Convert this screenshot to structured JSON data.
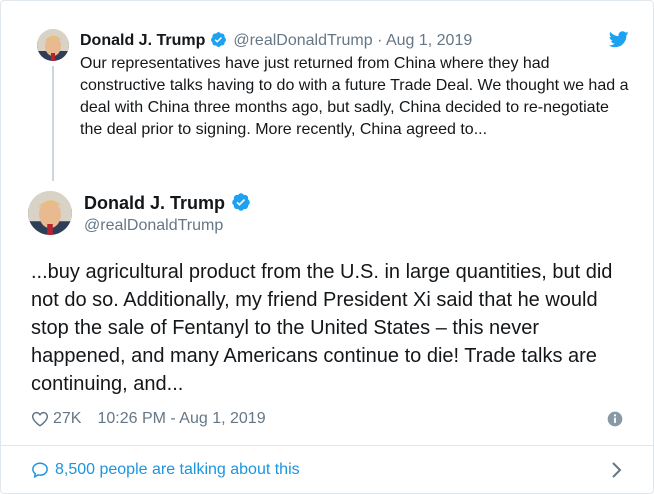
{
  "quoted": {
    "name": "Donald J. Trump",
    "handle": "@realDonaldTrump",
    "separator": "·",
    "date": "Aug 1, 2019",
    "text": "Our representatives have just returned from China where they had constructive talks having to do with a future Trade Deal. We thought we had a deal with China three months ago, but sadly, China decided to re-negotiate the deal prior to signing. More recently, China agreed to..."
  },
  "main": {
    "name": "Donald J. Trump",
    "handle": "@realDonaldTrump",
    "text": "...buy agricultural product from the U.S. in large quantities, but did not do so. Additionally, my friend President Xi said that he would stop the sale of Fentanyl to the United States – this never happened, and many Americans continue to die! Trade talks are continuing, and...",
    "likes": "27K",
    "timestamp": "10:26 PM - Aug 1, 2019"
  },
  "footer": {
    "talking": "8,500 people are talking about this"
  },
  "icons": {
    "verified": "verified-badge-icon",
    "bird": "twitter-bird-icon",
    "like": "heart-icon",
    "info": "info-icon",
    "talk": "speech-bubble-icon",
    "chevron": "chevron-right-icon"
  },
  "colors": {
    "accent": "#1b95e0",
    "verified": "#1da1f2",
    "text": "#14171a",
    "muted": "#657786",
    "border": "#e1e8ed"
  }
}
